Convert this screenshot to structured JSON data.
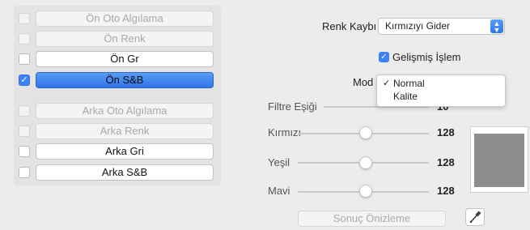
{
  "left_panel": {
    "front": [
      {
        "label": "Ön Oto Algılama",
        "checked": false,
        "enabled": false
      },
      {
        "label": "Ön Renk",
        "checked": false,
        "enabled": false
      },
      {
        "label": "Ön Gr",
        "checked": false,
        "enabled": true
      },
      {
        "label": "Ön S&B",
        "checked": true,
        "enabled": true
      }
    ],
    "back": [
      {
        "label": "Arka Oto Algılama",
        "checked": false,
        "enabled": false
      },
      {
        "label": "Arka Renk",
        "checked": false,
        "enabled": false
      },
      {
        "label": "Arka Gri",
        "checked": false,
        "enabled": true
      },
      {
        "label": "Arka S&B",
        "checked": false,
        "enabled": true
      }
    ]
  },
  "right_panel": {
    "renk_kaybi_label": "Renk Kaybı",
    "renk_kaybi_value": "Kırmızıyı Gider",
    "gelismis_label": "Gelişmiş İşlem",
    "gelismis_checked": true,
    "mod_label": "Mod",
    "mod_options": [
      "Normal",
      "Kalite"
    ],
    "mod_selected": "Normal",
    "filtre_label": "Filtre Eşiği",
    "filtre_value": "10",
    "sliders": [
      {
        "label": "Kırmızı",
        "value": "128"
      },
      {
        "label": "Yeşil",
        "value": "128"
      },
      {
        "label": "Mavi",
        "value": "128"
      }
    ],
    "preview_button": "Sonuç Önizleme"
  },
  "colors": {
    "accent": "#3e82f7",
    "panel_bg": "#e3e3e3",
    "preview_swatch": "#8d8d8d"
  }
}
